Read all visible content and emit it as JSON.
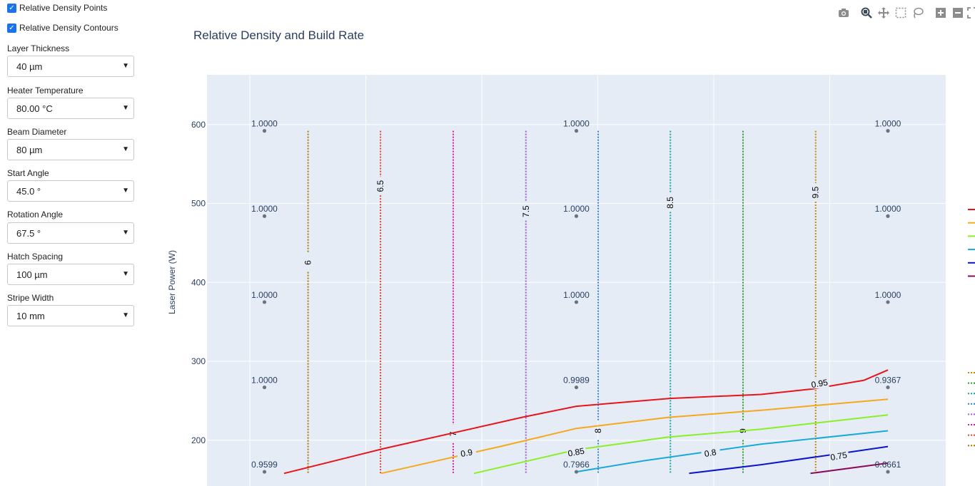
{
  "sidebar": {
    "checkboxes": [
      {
        "label": "Relative Density Points",
        "checked": true
      },
      {
        "label": "Relative Density Contours",
        "checked": true
      }
    ],
    "fields": [
      {
        "label": "Layer Thickness",
        "value": "40 µm"
      },
      {
        "label": "Heater Temperature",
        "value": "80.00 °C"
      },
      {
        "label": "Beam Diameter",
        "value": "80 µm"
      },
      {
        "label": "Start Angle",
        "value": "45.0 °"
      },
      {
        "label": "Rotation Angle",
        "value": "67.5 °"
      },
      {
        "label": "Hatch Spacing",
        "value": "100 µm"
      },
      {
        "label": "Stripe Width",
        "value": "10 mm"
      }
    ]
  },
  "modebar": {
    "icons": [
      "camera-icon",
      "zoom-icon",
      "pan-icon",
      "box-select-icon",
      "lasso-select-icon",
      "zoom-in-icon",
      "zoom-out-icon",
      "autoscale-icon"
    ]
  },
  "chart_data": {
    "type": "scatter",
    "title": "Relative Density and Build Rate",
    "xlabel": "",
    "ylabel": "Laser Power (W)",
    "ylim": [
      142,
      663
    ],
    "grid": true,
    "y_ticks": [
      200,
      300,
      400,
      500,
      600
    ],
    "x_tick_labels": [],
    "points": [
      {
        "x": 0.0778,
        "y": 160,
        "label": "0.9599"
      },
      {
        "x": 0.0778,
        "y": 267,
        "label": "1.0000"
      },
      {
        "x": 0.0778,
        "y": 375,
        "label": "1.0000"
      },
      {
        "x": 0.0778,
        "y": 484,
        "label": "1.0000"
      },
      {
        "x": 0.0778,
        "y": 592,
        "label": "1.0000"
      },
      {
        "x": 0.5,
        "y": 160,
        "label": "0.7966"
      },
      {
        "x": 0.5,
        "y": 267,
        "label": "0.9989"
      },
      {
        "x": 0.5,
        "y": 375,
        "label": "1.0000"
      },
      {
        "x": 0.5,
        "y": 484,
        "label": "1.0000"
      },
      {
        "x": 0.5,
        "y": 592,
        "label": "1.0000"
      },
      {
        "x": 0.9217,
        "y": 160,
        "label": "0.6661"
      },
      {
        "x": 0.9217,
        "y": 267,
        "label": "0.9367"
      },
      {
        "x": 0.9217,
        "y": 375,
        "label": "1.0000"
      },
      {
        "x": 0.9217,
        "y": 484,
        "label": "1.0000"
      },
      {
        "x": 0.9217,
        "y": 592,
        "label": "1.0000"
      }
    ],
    "density_contours": [
      {
        "level": "0.95",
        "color": "#e8141c",
        "points": [
          [
            0.1043,
            158
          ],
          [
            0.2377,
            189
          ],
          [
            0.4266,
            229
          ],
          [
            0.5,
            243
          ],
          [
            0.6266,
            253
          ],
          [
            0.75,
            258
          ],
          [
            0.8201,
            265
          ],
          [
            0.8895,
            276
          ],
          [
            0.9217,
            289
          ]
        ],
        "label_at": [
          0.8295,
          270
        ]
      },
      {
        "level": "0.9",
        "color": "#f5a91a",
        "points": [
          [
            0.2358,
            158
          ],
          [
            0.4014,
            193
          ],
          [
            0.5,
            215
          ],
          [
            0.625,
            229
          ],
          [
            0.75,
            238
          ],
          [
            0.9217,
            252
          ]
        ],
        "label_at": [
          0.3517,
          182
        ]
      },
      {
        "level": "0.85",
        "color": "#88f024",
        "points": [
          [
            0.3614,
            158
          ],
          [
            0.5,
            188
          ],
          [
            0.625,
            204
          ],
          [
            0.75,
            214
          ],
          [
            0.9217,
            232
          ]
        ],
        "label_at": [
          0.5,
          183
        ]
      },
      {
        "level": "0.8",
        "color": "#17aad9",
        "points": [
          [
            0.5,
            160
          ],
          [
            0.5911,
            174
          ],
          [
            0.75,
            195
          ],
          [
            0.9217,
            212
          ]
        ],
        "label_at": [
          0.6817,
          182
        ]
      },
      {
        "level": "0.75",
        "color": "#0a14cc",
        "points": [
          [
            0.6527,
            158
          ],
          [
            0.75,
            169
          ],
          [
            0.8556,
            183
          ],
          [
            0.9217,
            192
          ]
        ],
        "label_at": [
          0.8555,
          178
        ]
      },
      {
        "level": "",
        "color": "#8c0a5a",
        "points": [
          [
            0.8169,
            158
          ],
          [
            0.9217,
            171
          ]
        ],
        "label_at": null
      }
    ],
    "build_rate_contours": [
      {
        "level": "6",
        "color": "#a87a00",
        "x": 0.1368,
        "label_y": 425
      },
      {
        "level": "6.5",
        "color": "#e0453e",
        "x": 0.2349,
        "label_y": 522
      },
      {
        "level": "7",
        "color": "#d9219f",
        "x": 0.3333,
        "label_y": 208
      },
      {
        "level": "7.5",
        "color": "#a45ee3",
        "x": 0.4317,
        "label_y": 490
      },
      {
        "level": "8",
        "color": "#2f7fd6",
        "x": 0.5295,
        "label_y": 212
      },
      {
        "level": "8.5",
        "color": "#18a3a3",
        "x": 0.6273,
        "label_y": 501
      },
      {
        "level": "9",
        "color": "#2e9c2e",
        "x": 0.7256,
        "label_y": 212
      },
      {
        "level": "9.5",
        "color": "#c48a0c",
        "x": 0.8239,
        "label_y": 514
      }
    ],
    "legend_density_colors": [
      "#e8141c",
      "#f5a91a",
      "#88f024",
      "#17aad9",
      "#0a14cc",
      "#8c0a5a"
    ],
    "legend_build_colors": [
      "#c48a0c",
      "#2e9c2e",
      "#18a3a3",
      "#2f7fd6",
      "#a45ee3",
      "#d9219f",
      "#e0453e",
      "#a87a00"
    ]
  }
}
